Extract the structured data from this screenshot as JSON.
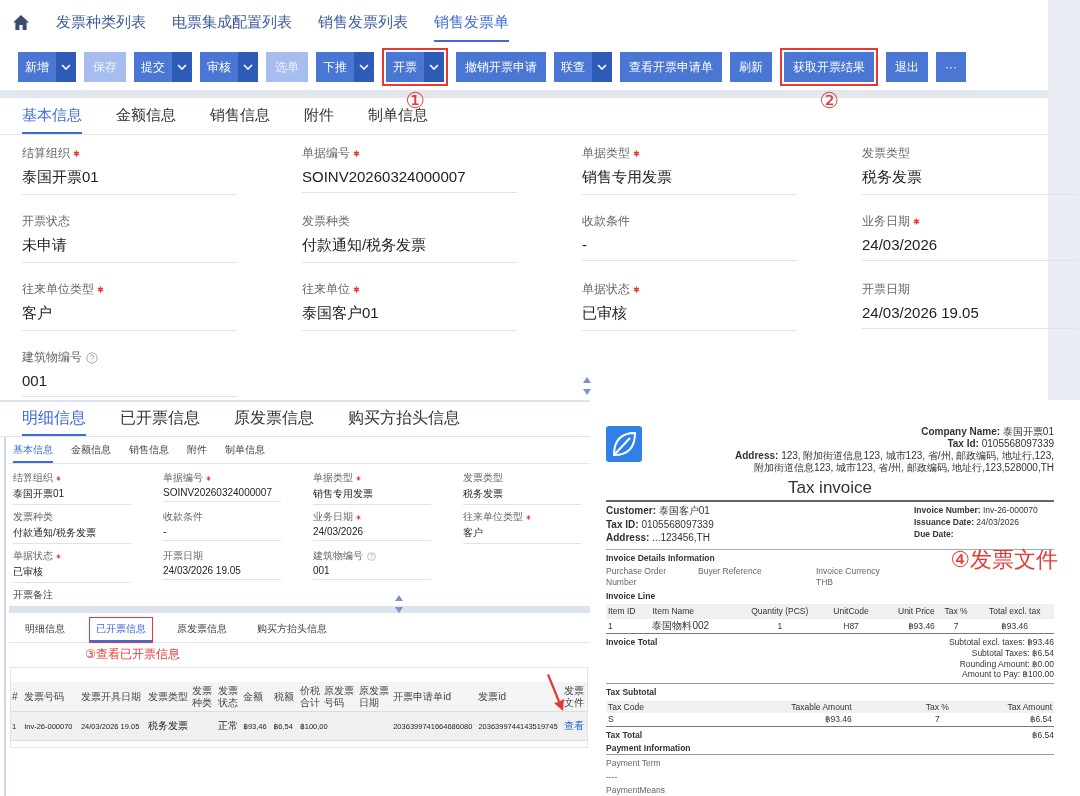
{
  "nav": {
    "tabs": [
      {
        "label": "发票种类列表",
        "selected": false
      },
      {
        "label": "电票集成配置列表",
        "selected": false
      },
      {
        "label": "销售发票列表",
        "selected": false
      },
      {
        "label": "销售发票单",
        "selected": true
      }
    ]
  },
  "toolbar": [
    {
      "label": "新增",
      "kind": "split",
      "disabled": false,
      "highlighted": false
    },
    {
      "label": "保存",
      "kind": "button",
      "disabled": true,
      "highlighted": false
    },
    {
      "label": "提交",
      "kind": "split",
      "disabled": false,
      "highlighted": false
    },
    {
      "label": "审核",
      "kind": "split",
      "disabled": false,
      "highlighted": false
    },
    {
      "label": "选单",
      "kind": "button",
      "disabled": true,
      "highlighted": false
    },
    {
      "label": "下推",
      "kind": "split",
      "disabled": false,
      "highlighted": false
    },
    {
      "label": "开票",
      "kind": "split",
      "disabled": false,
      "highlighted": true,
      "callout": "①"
    },
    {
      "label": "撤销开票申请",
      "kind": "button",
      "disabled": false,
      "highlighted": false
    },
    {
      "label": "联查",
      "kind": "split",
      "disabled": false,
      "highlighted": false
    },
    {
      "label": "查看开票申请单",
      "kind": "button",
      "disabled": false,
      "highlighted": false
    },
    {
      "label": "刷新",
      "kind": "button",
      "disabled": false,
      "highlighted": false
    },
    {
      "label": "获取开票结果",
      "kind": "button",
      "disabled": false,
      "highlighted": true,
      "callout": "②"
    },
    {
      "label": "退出",
      "kind": "button",
      "disabled": false,
      "highlighted": false
    },
    {
      "label": "···",
      "kind": "button",
      "disabled": false,
      "highlighted": false
    }
  ],
  "form_tabs": [
    {
      "label": "基本信息",
      "selected": true
    },
    {
      "label": "金额信息",
      "selected": false
    },
    {
      "label": "销售信息",
      "selected": false
    },
    {
      "label": "附件",
      "selected": false
    },
    {
      "label": "制单信息",
      "selected": false
    }
  ],
  "fields": [
    {
      "label": "结算组织",
      "required": true,
      "help": false,
      "value": "泰国开票01"
    },
    {
      "label": "单据编号",
      "required": true,
      "help": false,
      "value": "SOINV20260324000007"
    },
    {
      "label": "单据类型",
      "required": true,
      "help": false,
      "value": "销售专用发票"
    },
    {
      "label": "发票类型",
      "required": false,
      "help": false,
      "value": "税务发票"
    },
    {
      "label": "开票状态",
      "required": false,
      "help": false,
      "value": "未申请"
    },
    {
      "label": "发票种类",
      "required": false,
      "help": false,
      "value": "付款通知/税务发票"
    },
    {
      "label": "收款条件",
      "required": false,
      "help": false,
      "value": "-"
    },
    {
      "label": "业务日期",
      "required": true,
      "help": false,
      "value": "24/03/2026"
    },
    {
      "label": "往来单位类型",
      "required": true,
      "help": false,
      "value": "客户"
    },
    {
      "label": "往来单位",
      "required": true,
      "help": false,
      "value": "泰国客户01"
    },
    {
      "label": "单据状态",
      "required": true,
      "help": false,
      "value": "已审核"
    },
    {
      "label": "开票日期",
      "required": false,
      "help": false,
      "value": "24/03/2026 19.05"
    },
    {
      "label": "建筑物编号",
      "required": false,
      "help": true,
      "value": "001"
    }
  ],
  "detail_tabs": [
    {
      "label": "明细信息",
      "selected": true
    },
    {
      "label": "已开票信息",
      "selected": false
    },
    {
      "label": "原发票信息",
      "selected": false
    },
    {
      "label": "购买方抬头信息",
      "selected": false
    }
  ],
  "inset": {
    "form_tabs": [
      {
        "label": "基本信息",
        "selected": true
      },
      {
        "label": "金额信息",
        "selected": false
      },
      {
        "label": "销售信息",
        "selected": false
      },
      {
        "label": "附件",
        "selected": false
      },
      {
        "label": "制单信息",
        "selected": false
      }
    ],
    "fields": [
      {
        "label": "结算组织",
        "required": true,
        "help": false,
        "value": "泰国开票01"
      },
      {
        "label": "单据编号",
        "required": true,
        "help": false,
        "value": "SOINV20260324000007"
      },
      {
        "label": "单据类型",
        "required": true,
        "help": false,
        "value": "销售专用发票"
      },
      {
        "label": "发票类型",
        "required": false,
        "help": false,
        "value": "税务发票"
      },
      {
        "label": "发票种类",
        "required": false,
        "help": false,
        "value": "付款通知/税务发票"
      },
      {
        "label": "收款条件",
        "required": false,
        "help": false,
        "value": "-"
      },
      {
        "label": "业务日期",
        "required": true,
        "help": false,
        "value": "24/03/2026"
      },
      {
        "label": "往来单位类型",
        "required": true,
        "help": false,
        "value": "客户"
      },
      {
        "label": "单据状态",
        "required": true,
        "help": false,
        "value": "已审核"
      },
      {
        "label": "开票日期",
        "required": false,
        "help": false,
        "value": "24/03/2026 19.05"
      },
      {
        "label": "建筑物编号",
        "required": false,
        "help": true,
        "value": "001"
      }
    ],
    "remark": {
      "label": "开票备注"
    },
    "detail_tabs": [
      {
        "label": "明细信息",
        "selected": false,
        "highlighted": false
      },
      {
        "label": "已开票信息",
        "selected": true,
        "highlighted": true
      },
      {
        "label": "原发票信息",
        "selected": false,
        "highlighted": false
      },
      {
        "label": "购买方抬头信息",
        "selected": false,
        "highlighted": false
      }
    ],
    "callout": "③查看已开票信息",
    "table": {
      "columns": [
        {
          "label": "#",
          "kind": "text"
        },
        {
          "label": "发票号码",
          "kind": "text"
        },
        {
          "label": "发票开具日期",
          "kind": "text"
        },
        {
          "label": "发票类型",
          "kind": "text"
        },
        {
          "label": "发票种类",
          "kind": "text"
        },
        {
          "label": "发票状态",
          "kind": "text"
        },
        {
          "label": "金额",
          "kind": "text"
        },
        {
          "label": "税额",
          "kind": "text"
        },
        {
          "label": "价税合计",
          "kind": "text"
        },
        {
          "label": "原发票号码",
          "kind": "text"
        },
        {
          "label": "原发票日期",
          "kind": "text"
        },
        {
          "label": "开票申请单id",
          "kind": "text"
        },
        {
          "label": "发票id",
          "kind": "text"
        },
        {
          "label": "发票文件",
          "kind": "link"
        }
      ],
      "rows": [
        [
          "1",
          "Inv-26-000070",
          "24/03/2026 19.05",
          "税务发票",
          null,
          "正常",
          "฿93,46",
          "฿6,54",
          "฿100,00",
          null,
          null,
          "2036399741664686080",
          "2036399744143519745",
          "查看"
        ]
      ]
    }
  },
  "invoice": {
    "company": [
      "**Company Name:** 泰国开票01",
      "**Tax Id:** 0105568097339",
      "**Address:** 123, 附加街道信息123, 城市123, 省/州, 邮政编码, 地址行,123, 附加街道信息123, 城市123, 省/州, 邮政编码, 地址行,123,528000,TH"
    ],
    "title": "Tax invoice",
    "customer": [
      "**Customer:** 泰国客户01",
      "**Tax ID:** 0105568097339",
      "**Address:** ...123456,TH"
    ],
    "meta": [
      "**Invoice Number:** Inv-26-000070",
      "**Issuance Date:** 24/03/2026",
      "**Due Date:**"
    ],
    "details": {
      "heading": "Invoice Details Information",
      "fields": [
        {
          "label": "Purchase Order Number"
        },
        {
          "label": "Buyer Reference"
        },
        {
          "label": "Invoice Currency",
          "value": "THB"
        }
      ]
    },
    "lines": {
      "heading": "Invoice Line",
      "columns": [
        "Item ID",
        "Item Name",
        "Quantity (PCS)",
        "UnitCode",
        "Unit Price",
        "Tax %",
        "Total excl. tax"
      ],
      "rows": [
        [
          "1",
          "泰国物料002",
          "1",
          "H87",
          "฿93.46",
          "7",
          "฿93.46"
        ]
      ]
    },
    "total": {
      "heading": "Invoice Total",
      "lines": [
        "Subtotal excl. taxes: ฿93.46",
        "Subtotal Taxes: ฿6.54",
        "Rounding Amount: ฿0.00",
        "Amount to Pay: ฿100.00"
      ]
    },
    "tax": {
      "heading": "Tax Subtotal",
      "columns": [
        "Tax Code",
        "Taxable Amount",
        "Tax %",
        "Tax Amount"
      ],
      "rows": [
        [
          "S",
          "฿93.46",
          "7",
          "฿6.54"
        ]
      ]
    },
    "tax_total": {
      "label": "Tax Total",
      "value": "฿6.54"
    },
    "payment": {
      "heading": "Payment Information",
      "items": [
        "Payment Term",
        "----",
        "PaymentMeans"
      ]
    },
    "callout": "④发票文件"
  }
}
